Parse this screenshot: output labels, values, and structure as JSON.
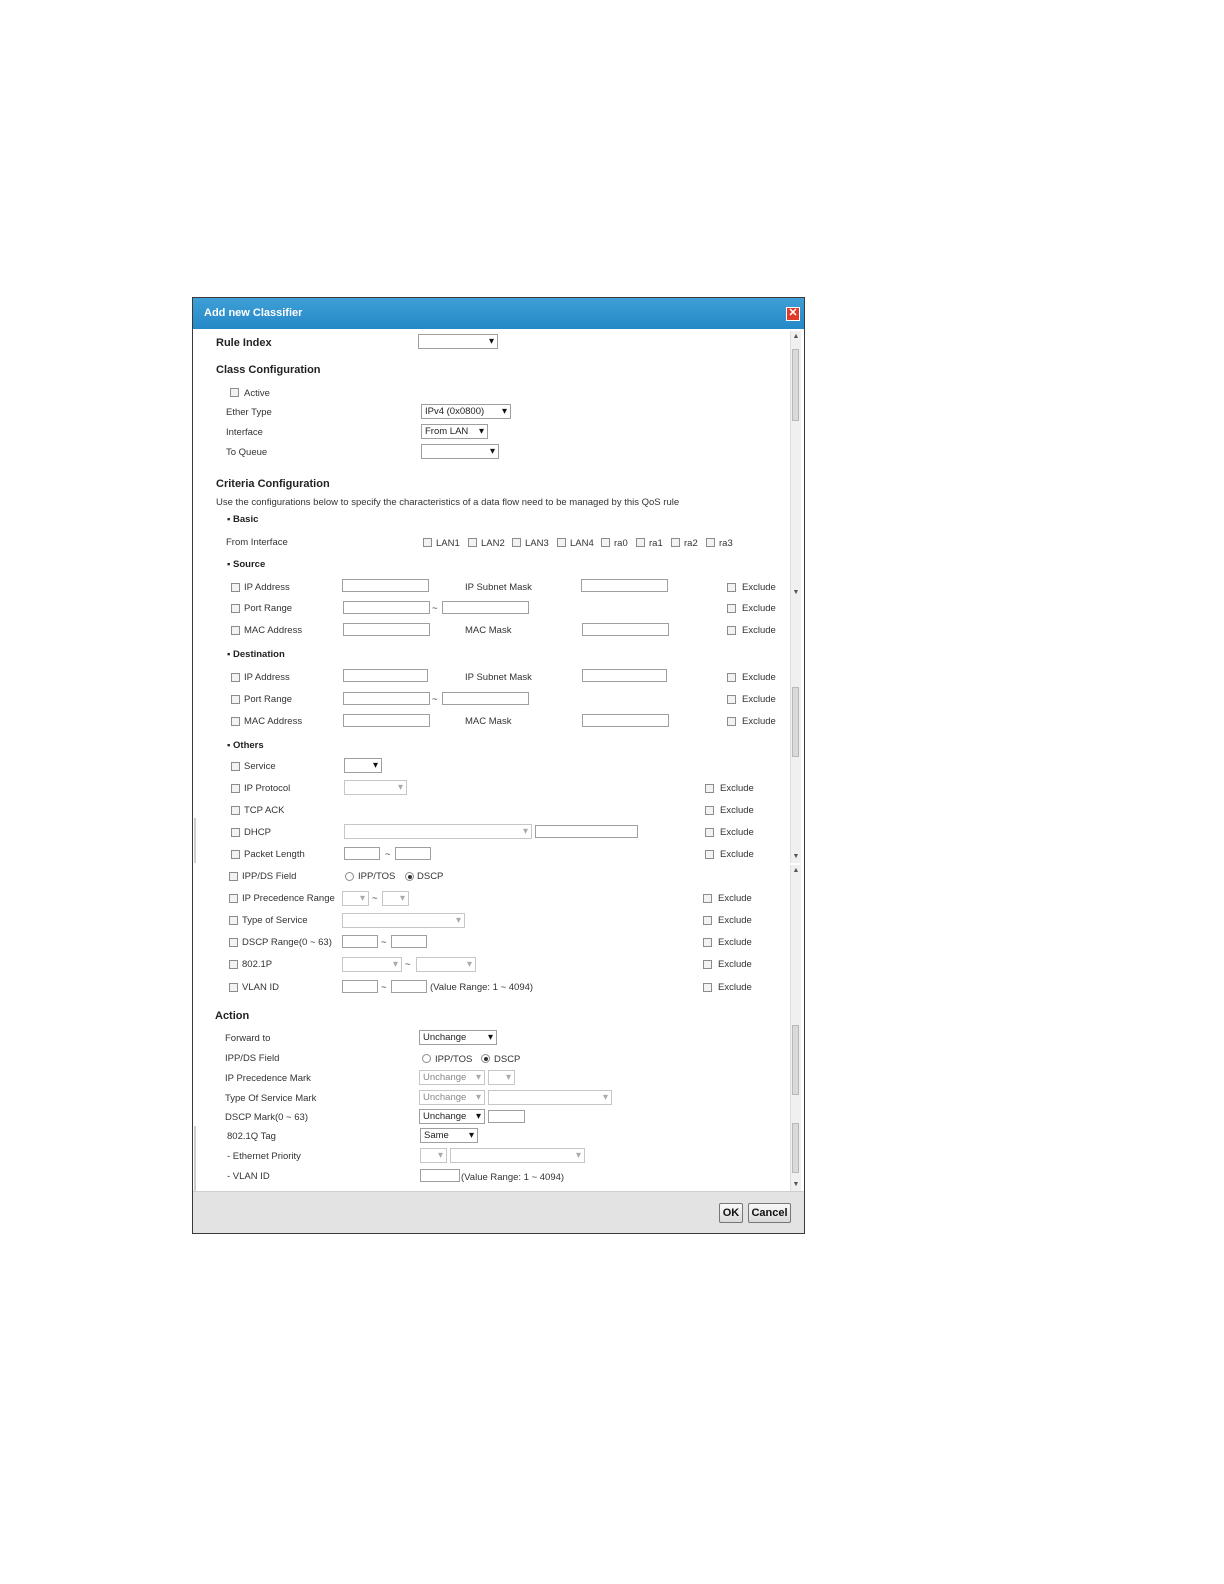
{
  "dialog": {
    "title": "Add new Classifier"
  },
  "rule_index": {
    "label": "Rule Index",
    "value": ""
  },
  "class_config": {
    "heading": "Class Configuration",
    "active_label": "Active",
    "ether_type_label": "Ether Type",
    "ether_type_value": "IPv4 (0x0800)",
    "interface_label": "Interface",
    "interface_value": "From LAN",
    "queue_label": "To Queue",
    "queue_value": ""
  },
  "criteria": {
    "heading": "Criteria Configuration",
    "description": "Use the configurations below to specify the characteristics of a data flow need to be managed by this QoS rule",
    "basic_heading": "Basic",
    "from_interface_label": "From Interface",
    "interfaces": [
      "LAN1",
      "LAN2",
      "LAN3",
      "LAN4",
      "ra0",
      "ra1",
      "ra2",
      "ra3"
    ],
    "source_heading": "Source",
    "destination_heading": "Destination",
    "others_heading": "Others",
    "ip_address": "IP Address",
    "ip_subnet_mask": "IP Subnet Mask",
    "port_range": "Port Range",
    "mac_address": "MAC Address",
    "mac_mask": "MAC Mask",
    "exclude": "Exclude",
    "tilde": "~",
    "service": "Service",
    "ip_protocol": "IP Protocol",
    "tcp_ack": "TCP ACK",
    "dhcp": "DHCP",
    "packet_length": "Packet Length",
    "ipp_ds_field": "IPP/DS Field",
    "ipp_tos": "IPP/TOS",
    "dscp": "DSCP",
    "ip_precedence_range": "IP Precedence Range",
    "type_of_service": "Type of Service",
    "dscp_range": "DSCP Range(0 ~ 63)",
    "p8021p": "802.1P",
    "vlan_id": "VLAN ID",
    "vlan_range": "(Value Range: 1 ~ 4094)"
  },
  "action": {
    "heading": "Action",
    "forward_to_label": "Forward to",
    "forward_to_value": "Unchange",
    "ipp_ds_label": "IPP/DS Field",
    "ipp_tos": "IPP/TOS",
    "dscp": "DSCP",
    "ip_precedence_label": "IP Precedence Mark",
    "ip_precedence_value": "Unchange",
    "tos_mark_label": "Type Of Service Mark",
    "tos_mark_value": "Unchange",
    "dscp_mark_label": "DSCP Mark(0 ~ 63)",
    "dscp_mark_value": "Unchange",
    "tag_label": "802.1Q Tag",
    "tag_value": "Same",
    "ethernet_priority_label": "- Ethernet Priority",
    "vlan_id_label": "- VLAN ID",
    "vlan_range": "(Value Range: 1 ~ 4094)"
  },
  "buttons": {
    "ok": "OK",
    "cancel": "Cancel"
  }
}
